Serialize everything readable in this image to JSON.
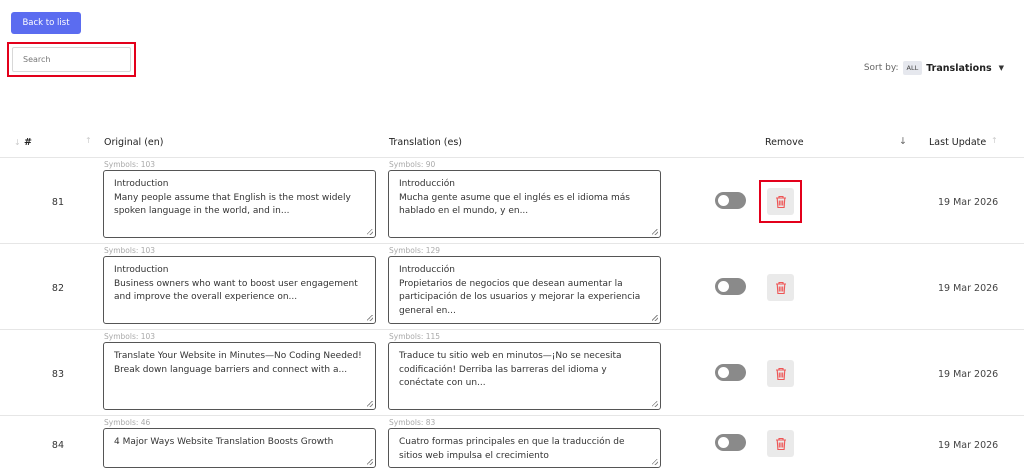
{
  "toolbar": {
    "back_label": "Back to list"
  },
  "search": {
    "placeholder": "Search",
    "value": ""
  },
  "sort": {
    "label": "Sort by:",
    "badge": "ALL",
    "value": "Translations"
  },
  "table": {
    "columns": {
      "number": "#",
      "original": "Original (en)",
      "translation": "Translation (es)",
      "remove": "Remove",
      "last_update": "Last Update"
    },
    "rows": [
      {
        "number": "81",
        "orig_symbols": "Symbols: 103",
        "original": "Introduction\nMany people assume that English is the most widely\nspoken language in the world, and in...",
        "trans_symbols": "Symbols: 90",
        "translation": "Introducción\nMucha gente asume que el inglés es el idioma más\nhablado en el mundo, y en...",
        "toggle_on": false,
        "last_update": "19 Mar 2026"
      },
      {
        "number": "82",
        "orig_symbols": "Symbols: 103",
        "original": "Introduction\nBusiness owners who want to boost user engagement\nand improve the overall experience on...",
        "trans_symbols": "Symbols: 129",
        "translation": "Introducción\nPropietarios de negocios que desean aumentar la\nparticipación de los usuarios y mejorar la experiencia\ngeneral en...",
        "toggle_on": false,
        "last_update": "19 Mar 2026"
      },
      {
        "number": "83",
        "orig_symbols": "Symbols: 103",
        "original": "Translate Your Website in Minutes—No Coding Needed!\nBreak down language barriers and connect with a...",
        "trans_symbols": "Symbols: 115",
        "translation": "Traduce tu sitio web en minutos—¡No se necesita\ncodificación! Derriba las barreras del idioma y\nconéctate con un...",
        "toggle_on": false,
        "last_update": "19 Mar 2026"
      },
      {
        "number": "84",
        "orig_symbols": "Symbols: 46",
        "original": "4 Major Ways Website Translation Boosts Growth",
        "trans_symbols": "Symbols: 83",
        "translation": "Cuatro formas principales en que la traducción de\nsitios web impulsa el crecimiento",
        "toggle_on": false,
        "last_update": "19 Mar 2026"
      }
    ]
  },
  "colors": {
    "accent": "#5b6cf0",
    "highlight": "#e3001b",
    "trash": "#ee5555"
  },
  "icons": {
    "remove": "trash-icon",
    "sort": "sort-arrow-icon",
    "dropdown": "caret-down-icon"
  }
}
